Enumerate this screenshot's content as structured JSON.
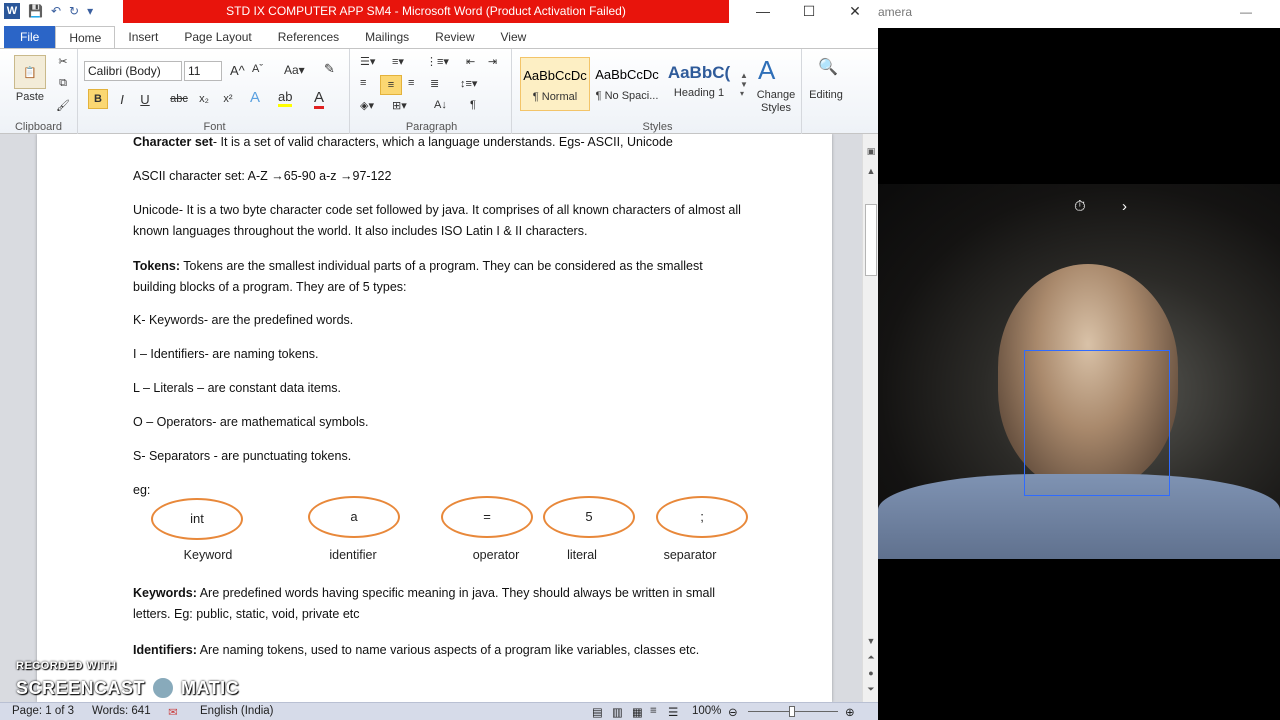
{
  "window": {
    "title": "STD IX COMPUTER APP SM4  -  Microsoft Word (Product Activation Failed)",
    "minimize": "—",
    "maximize": "☐",
    "close": "✕"
  },
  "tabs": [
    "File",
    "Home",
    "Insert",
    "Page Layout",
    "References",
    "Mailings",
    "Review",
    "View"
  ],
  "ribbon": {
    "clipboard": {
      "paste": "Paste",
      "label": "Clipboard"
    },
    "font": {
      "name": "Calibri (Body)",
      "size": "11",
      "label": "Font",
      "bold": "B",
      "italic": "I",
      "underline": "U",
      "strike": "abc",
      "sub": "x₂",
      "sup": "x²"
    },
    "paragraph": {
      "label": "Paragraph"
    },
    "styles": {
      "label": "Styles",
      "items": [
        {
          "preview": "AaBbCcDc",
          "name": "¶ Normal"
        },
        {
          "preview": "AaBbCcDc",
          "name": "¶ No Spaci..."
        },
        {
          "preview": "AaBbC(",
          "name": "Heading 1"
        }
      ],
      "change_styles": "Change Styles"
    },
    "editing": {
      "label": "Editing"
    }
  },
  "doc": {
    "line0_bold": "Character set",
    "line0_rest": "- It is a set of valid characters, which a language understands. Egs- ASCII, Unicode",
    "ascii": "ASCII character set:       A-Z →65-90       a-z →97-122",
    "unicode": "Unicode- It is a two byte character code set followed by java. It comprises of all known characters of almost all known languages throughout the world. It also includes ISO Latin I & II characters.",
    "tokens_bold": "Tokens:",
    "tokens_rest": " Tokens are the smallest individual parts of a program. They can be considered as the smallest building blocks of a program. They are of 5 types:",
    "k": "K- Keywords- are the predefined words.",
    "i": "I – Identifiers- are naming tokens.",
    "l": "L – Literals – are constant data items.",
    "o": "O – Operators- are mathematical symbols.",
    "s": "S- Separators -  are punctuating tokens.",
    "eg": "eg:",
    "ovals": [
      {
        "value": "int",
        "label": "Keyword"
      },
      {
        "value": "a",
        "label": "identifier"
      },
      {
        "value": "=",
        "label": "operator"
      },
      {
        "value": "5",
        "label": "literal"
      },
      {
        "value": ";",
        "label": "separator"
      }
    ],
    "keywords_bold": "Keywords:",
    "keywords_rest": " Are predefined words having specific meaning in java. They should always be written in small letters. Eg: public, static, void, private etc",
    "identifiers_bold": "Identifiers:",
    "identifiers_rest": " Are naming tokens, used to name various aspects of a program like variables, classes etc."
  },
  "status": {
    "page": "Page: 1 of 3",
    "words": "Words: 641",
    "language": "English (India)",
    "zoom": "100%"
  },
  "camera": {
    "title": "amera"
  },
  "watermark": {
    "line1": "RECORDED WITH",
    "line2a": "SCREENCAST",
    "line2b": "MATIC"
  }
}
